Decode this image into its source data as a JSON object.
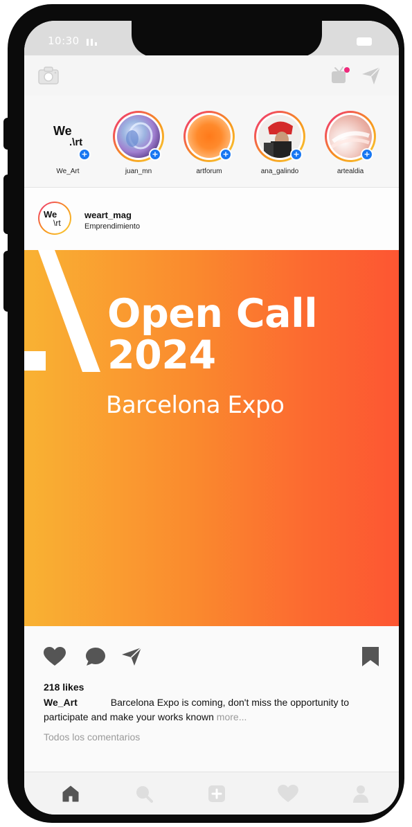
{
  "status": {
    "time": "10:30"
  },
  "stories": [
    {
      "name": "We_Art",
      "logo_line1": "We",
      "logo_line2": ".\\rt"
    },
    {
      "name": "juan_mn"
    },
    {
      "name": "artforum"
    },
    {
      "name": "ana_galindo"
    },
    {
      "name": "artealdia"
    }
  ],
  "post": {
    "username": "weart_mag",
    "subtitle": "Emprendimiento",
    "avatar_line1": "We",
    "avatar_line2": "\\rt",
    "banner": {
      "title_line1": "Open Call",
      "title_line2": "2024",
      "subtitle": "Barcelona Expo"
    },
    "likes": "218 likes",
    "caption_user": "We_Art",
    "caption_text": "Barcelona Expo is coming, don't miss the opportunity to participate and make your works known",
    "caption_more": "more...",
    "comments_link": "Todos los comentarios"
  },
  "colors": {
    "accent_blue": "#1877f2",
    "banner_start": "#f9b233",
    "banner_end": "#fd5632",
    "icon_gray": "#555555"
  },
  "icons": {
    "appbar": [
      "camera-icon",
      "tv-icon",
      "send-icon"
    ],
    "actions": [
      "heart-icon",
      "comment-icon",
      "share-icon",
      "bookmark-icon"
    ],
    "nav": [
      "home-icon",
      "search-icon",
      "add-icon",
      "heart-icon",
      "profile-icon"
    ]
  }
}
